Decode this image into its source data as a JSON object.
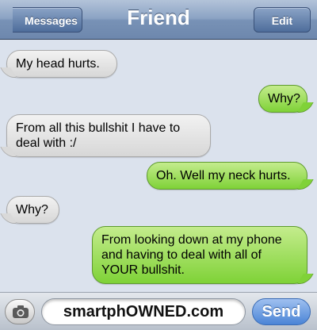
{
  "navbar": {
    "back_label": "Messages",
    "title": "Friend",
    "edit_label": "Edit"
  },
  "messages": [
    {
      "direction": "received",
      "text": "My head hurts."
    },
    {
      "direction": "sent",
      "text": "Why?"
    },
    {
      "direction": "received",
      "text": "From all this bullshit I have to deal with :/"
    },
    {
      "direction": "sent",
      "text": "Oh. Well my neck hurts."
    },
    {
      "direction": "received",
      "text": "Why?"
    },
    {
      "direction": "sent",
      "text": "From looking down at my phone and having to deal with all of YOUR bullshit."
    }
  ],
  "composer": {
    "camera_icon": "camera-icon",
    "input_value": "smartphOWNED.com",
    "send_label": "Send"
  },
  "colors": {
    "navbar": "#7892b6",
    "sent_bubble": "#7fd237",
    "received_bubble": "#e2e2e2",
    "send_button": "#4a84d6",
    "background": "#dbe2ed"
  }
}
